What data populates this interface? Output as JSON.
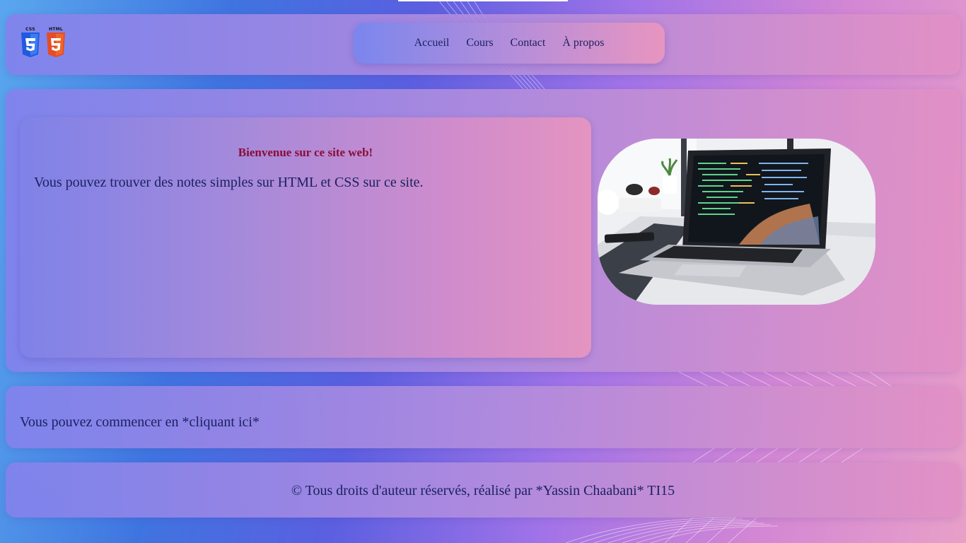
{
  "brand": {
    "css_logo": "CSS",
    "html_logo": "HTML"
  },
  "nav": {
    "items": [
      "Accueil",
      "Cours",
      "Contact",
      "À propos"
    ]
  },
  "welcome": {
    "title": "Bienvenue sur ce site web!",
    "text": "Vous pouvez trouver des notes simples sur HTML et CSS sur ce site."
  },
  "start": {
    "text": "Vous pouvez commencer en *cliquant ici*"
  },
  "footer": {
    "text": "© Tous droits d'auteur réservés, réalisé par  *Yassin Chaabani*  TI15"
  },
  "icons": {
    "css": "css3-shield-icon",
    "html": "html5-shield-icon",
    "hero": "laptop-code-photo"
  },
  "colors": {
    "css_blue": "#2965f1",
    "html_orange": "#e44d26",
    "title_red": "#8a0d3a",
    "text_navy": "#1c2260"
  }
}
